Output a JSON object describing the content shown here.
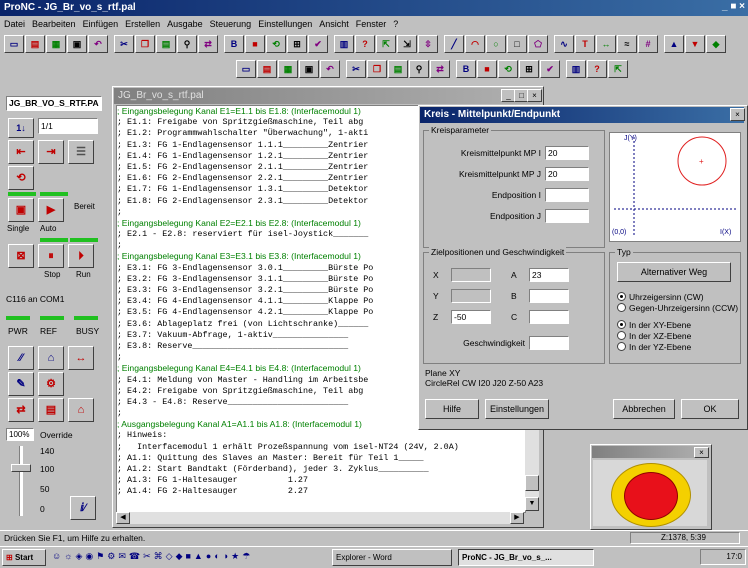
{
  "app": {
    "title": "ProNC - JG_Br_vo_s_rtf.pal",
    "win_controls": "_ ■ ×"
  },
  "menu": [
    "Datei",
    "Bearbeiten",
    "Einfügen",
    "Erstellen",
    "Ausgabe",
    "Steuerung",
    "Einstellungen",
    "Ansicht",
    "Fenster",
    "?"
  ],
  "toolbar1": [
    "new",
    "open",
    "save",
    "print",
    "undo",
    "cut",
    "copy",
    "paste",
    "find",
    "replace",
    "bold",
    "stop",
    "stepper",
    "io",
    "check",
    "graph",
    "help",
    "sel1",
    "sel2",
    "sel3",
    "line",
    "arc",
    "circ",
    "rect",
    "poly",
    "spline",
    "text",
    "dim",
    "wave",
    "grid",
    "tool1",
    "tool2",
    "tool3"
  ],
  "toolbar2": [
    "view1",
    "view2",
    "view3",
    "view4",
    "zoom1",
    "zoom2",
    "zoom3",
    "zoom4",
    "pan",
    "fit",
    "sim1",
    "sim2",
    "sim3",
    "sim4",
    "sim5",
    "tlib",
    "mat",
    "cfg"
  ],
  "left": {
    "file": "JG_BR_VO_S_RTF.PA",
    "counter_btn": "1↓",
    "counter_val": "1/1",
    "bereit": "Bereit",
    "single": "Single",
    "auto": "Auto",
    "stop": "Stop",
    "run": "Run",
    "port": "C116 an COM1",
    "pwr": "PWR",
    "ref": "REF",
    "busy": "BUSY",
    "override_pct": "100%",
    "override_label": "Override",
    "override_scale": [
      "140",
      "100",
      "50",
      "0"
    ]
  },
  "editor": {
    "title": "JG_Br_vo_s_rtf.pal",
    "lines": [
      {
        "hdr": true,
        "t": "; Eingangsbelegung Kanal E1=E1.1 bis E1.8: (Interfacemodul 1)"
      },
      {
        "t": "; E1.1: Freigabe von Spritzgießmaschine, Teil abg"
      },
      {
        "t": "; E1.2: Programmwahlschalter \"Überwachung\", 1-akti"
      },
      {
        "t": "; E1.3: FG 1-Endlagensensor 1.1.1_________Zentrier"
      },
      {
        "t": "; E1.4: FG 1-Endlagensensor 1.2.1_________Zentrier"
      },
      {
        "t": "; E1.5: FG 2-Endlagensensor 2.1.1_________Zentrier"
      },
      {
        "t": "; E1.6: FG 2-Endlagensensor 2.2.1_________Zentrier"
      },
      {
        "t": "; E1.7: FG 1-Endlagensensor 1.3.1_________Detektor"
      },
      {
        "t": "; E1.8: FG 2-Endlagensensor 2.3.1_________Detektor"
      },
      {
        "t": ";"
      },
      {
        "hdr": true,
        "t": "; Eingangsbelegung Kanal E2=E2.1 bis E2.8: (Interfacemodul 1)"
      },
      {
        "t": "; E2.1 - E2.8: reserviert für isel-Joystick_______"
      },
      {
        "t": ";"
      },
      {
        "hdr": true,
        "t": "; Eingangsbelegung Kanal E3=E3.1 bis E3.8: (Interfacemodul 1)"
      },
      {
        "t": "; E3.1: FG 3-Endlagensensor 3.0.1_________Bürste Po"
      },
      {
        "t": "; E3.2: FG 3-Endlagensensor 3.1.1_________Bürste Po"
      },
      {
        "t": "; E3.3: FG 3-Endlagensensor 3.2.1_________Bürste Po"
      },
      {
        "t": "; E3.4: FG 4-Endlagensensor 4.1.1_________Klappe Po"
      },
      {
        "t": "; E3.5: FG 4-Endlagensensor 4.2.1_________Klappe Po"
      },
      {
        "t": "; E3.6: Ablageplatz frei (von Lichtschranke)______"
      },
      {
        "t": "; E3.7: Vakuum-Abfrage, 1-aktiv_______________"
      },
      {
        "t": "; E3.8: Reserve_______________________________"
      },
      {
        "t": ";"
      },
      {
        "hdr": true,
        "t": "; Eingangsbelegung Kanal E4=E4.1 bis E4.8: (Interfacemodul 1)"
      },
      {
        "t": "; E4.1: Meldung von Master - Handling im Arbeitsbe"
      },
      {
        "t": "; E4.2: Freigabe von Spritzgießmaschine, Teil abg"
      },
      {
        "t": "; E4.3 - E4.8: Reserve________________________"
      },
      {
        "t": ";"
      },
      {
        "hdr": true,
        "t": "; Ausgangsbelegung Kanal A1=A1.1 bis A1.8: (Interfacemodul 1)"
      },
      {
        "t": "; Hinweis:"
      },
      {
        "t": ";   Interfacemodul 1 erhält Prozeßspannung vom isel-NT24 (24V, 2.0A)"
      },
      {
        "t": "; A1.1: Quittung des Slaves an Master: Bereit für Teil 1_____"
      },
      {
        "t": "; A1.2: Start Bandtakt (Förderband), jeder 3. Zyklus__________"
      },
      {
        "t": "; A1.3: FG 1-Haltesauger          1.27"
      },
      {
        "t": "; A1.4: FG 2-Haltesauger          2.27"
      }
    ]
  },
  "dialog": {
    "title": "Kreis - Mittelpunkt/Endpunkt",
    "group1": "Kreisparameter",
    "mp_i_label": "Kreismittelpunkt MP I",
    "mp_i": "20",
    "mp_j_label": "Kreismittelpunkt MP J",
    "mp_j": "20",
    "end_i_label": "Endposition I",
    "end_i": "",
    "end_j_label": "Endposition J",
    "end_j": "",
    "preview_y": "J(Y)",
    "preview_x": "I(X)",
    "preview_origin": "(0,0)",
    "group2": "Zielpositionen und Geschwindigkeit",
    "x_label": "X",
    "x": "",
    "y_label": "Y",
    "y": "",
    "z_label": "Z",
    "z": "-50",
    "a_label": "A",
    "a": "23",
    "b_label": "B",
    "b": "",
    "c_label": "C",
    "c": "",
    "speed_label": "Geschwindigkeit",
    "speed": "",
    "group3": "Typ",
    "alt_btn": "Alternativer Weg",
    "r_cw": "Uhrzeigersinn (CW)",
    "r_ccw": "Gegen-Uhrzeigersinn (CCW)",
    "r_xy": "In der XY-Ebene",
    "r_xz": "In der XZ-Ebene",
    "r_yz": "In der YZ-Ebene",
    "plane": "Plane XY",
    "cmd": "CircleRel CW I20 J20 Z-50 A23",
    "help_btn": "Hilfe",
    "settings_btn": "Einstellungen",
    "cancel_btn": "Abbrechen",
    "ok_btn": "OK",
    "close": "×"
  },
  "statusbar": {
    "hint": "Drücken Sie F1, um Hilfe zu erhalten.",
    "coords": "Z:1378, 5:39"
  },
  "taskbar": {
    "start": "Start",
    "task1": "Explorer - Word",
    "task2": "ProNC - JG_Br_vo_s_...",
    "clock": "17:0"
  },
  "colors": {
    "title": "#0a246a",
    "desktop": "#008080",
    "header_green": "#008000",
    "estop_red": "#e8101a",
    "estop_yellow": "#f4d000"
  }
}
